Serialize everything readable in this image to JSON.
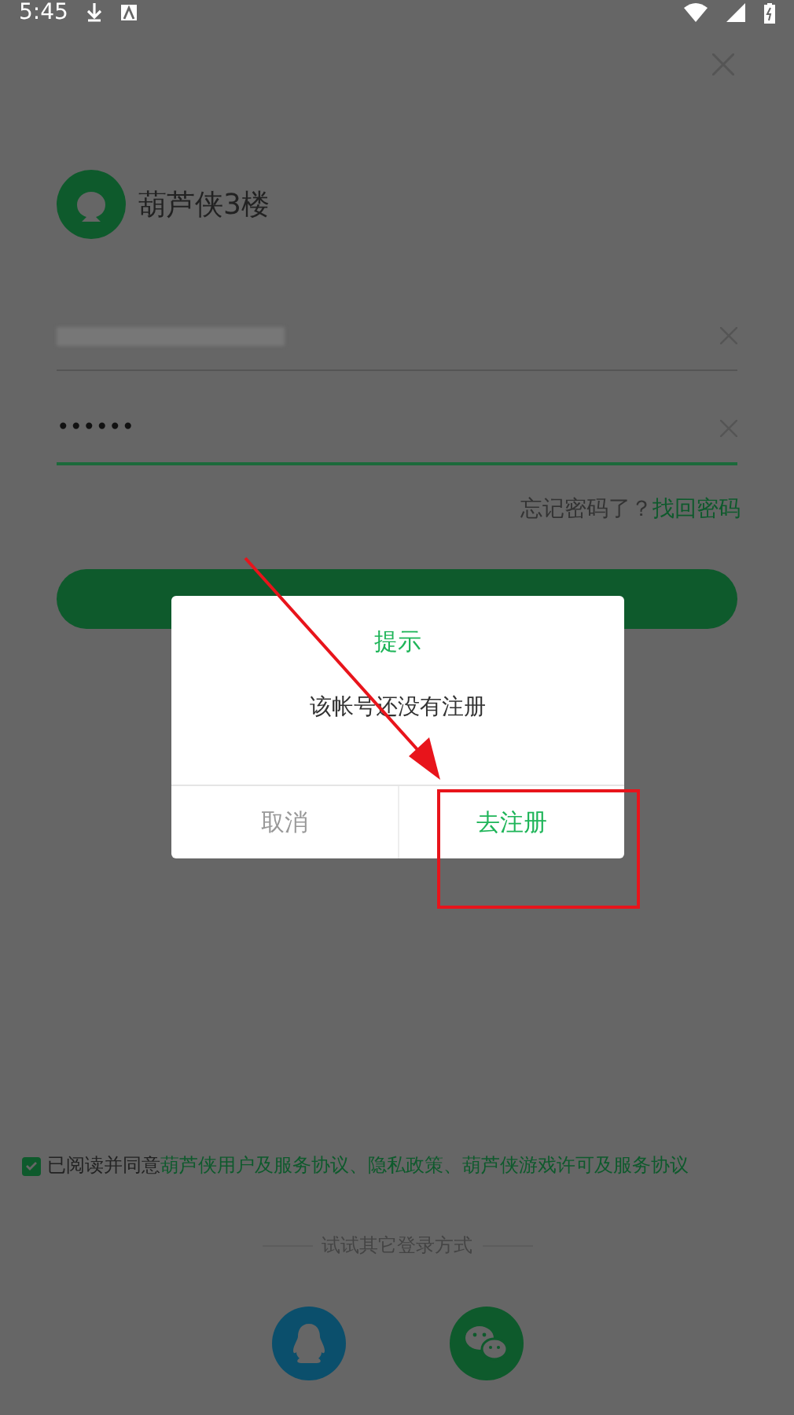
{
  "status_bar": {
    "time": "5:45"
  },
  "app": {
    "name": "葫芦侠3楼"
  },
  "password_field": {
    "value": "••••••"
  },
  "forgot": {
    "question": "忘记密码了？",
    "link": "找回密码"
  },
  "agreement": {
    "checked": true,
    "lead": "已阅读并同意",
    "links": [
      "葫芦侠用户及服务协议",
      "隐私政策",
      "葫芦侠游戏许可及服务协议"
    ],
    "separator": "、"
  },
  "other_login": {
    "label": "试试其它登录方式"
  },
  "dialog": {
    "title": "提示",
    "message": "该帐号还没有注册",
    "buttons": [
      {
        "label": "取消",
        "kind": "cancel"
      },
      {
        "label": "去注册",
        "kind": "confirm"
      }
    ]
  }
}
